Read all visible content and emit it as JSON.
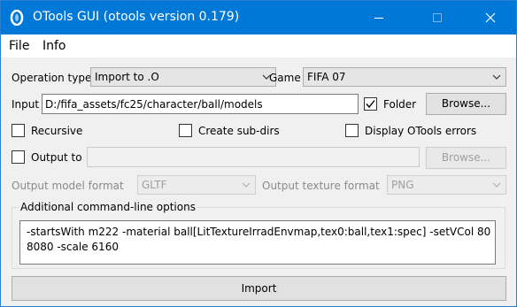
{
  "window": {
    "title": "OTools GUI (otools version 0.179)",
    "accent_color": "#0078d7",
    "controls": {
      "minimize": "minimize-icon",
      "maximize": "maximize-icon",
      "close": "close-icon"
    }
  },
  "menu": {
    "file": "File",
    "info": "Info"
  },
  "operation": {
    "label": "Operation type",
    "value": "Import to .O"
  },
  "game": {
    "label": "Game",
    "value": "FIFA 07"
  },
  "input": {
    "label": "Input",
    "value": "D:/fifa_assets/fc25/character/ball/models",
    "browse": "Browse..."
  },
  "folder": {
    "label": "Folder",
    "checked": true
  },
  "options": {
    "recursive": {
      "label": "Recursive",
      "checked": false
    },
    "create_subdirs": {
      "label": "Create sub-dirs",
      "checked": false
    },
    "display_errors": {
      "label": "Display OTools errors",
      "checked": false
    }
  },
  "output_to": {
    "label": "Output to",
    "checked": false,
    "value": "",
    "browse": "Browse..."
  },
  "model_format": {
    "label": "Output model format",
    "value": "GLTF"
  },
  "texture_format": {
    "label": "Output texture format",
    "value": "PNG"
  },
  "cmdline": {
    "label": "Additional command-line options",
    "value": "-startsWith m222 -material ball[LitTextureIrradEnvmap,tex0:ball,tex1:spec] -setVCol 808080 -scale 6160"
  },
  "import_button": "Import"
}
